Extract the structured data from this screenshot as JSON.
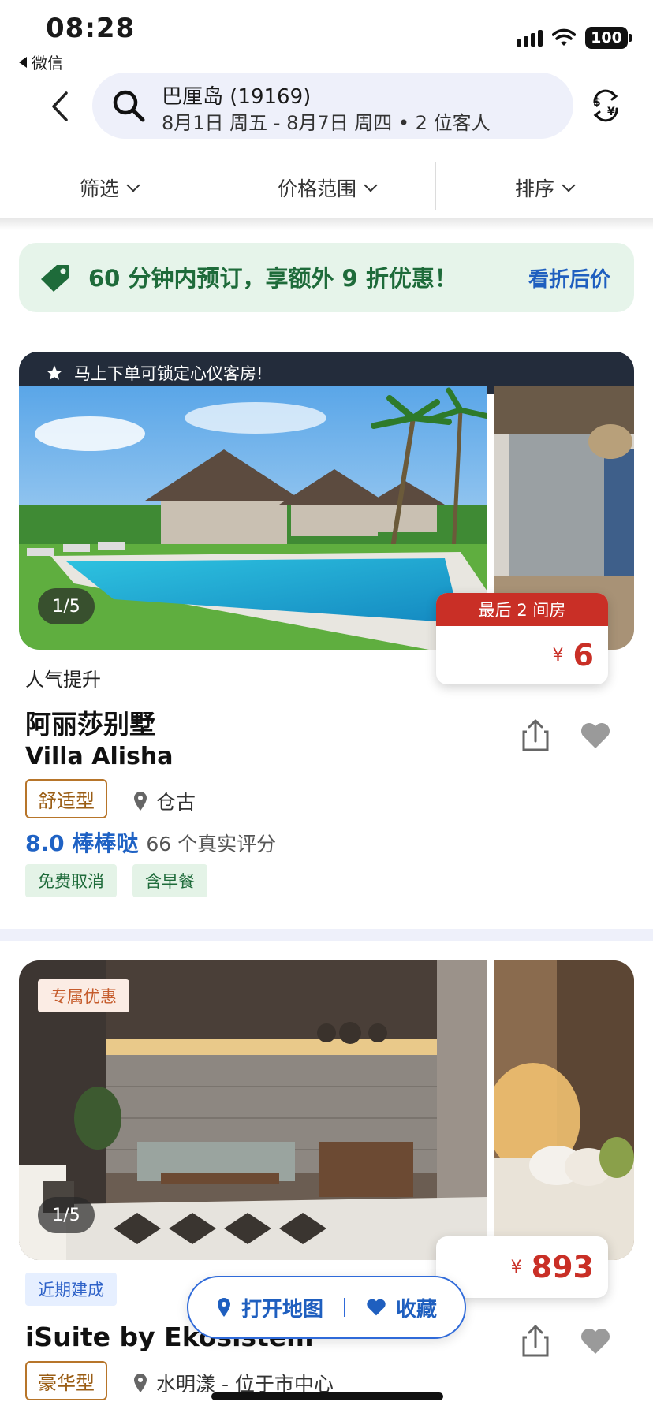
{
  "status_bar": {
    "time": "08:28",
    "back_app": "微信",
    "battery": "100"
  },
  "search": {
    "title": "巴厘岛 (19169)",
    "subtitle": "8月1日 周五 - 8月7日 周四 • 2 位客人"
  },
  "filters": {
    "filter": "筛选",
    "price_range": "价格范围",
    "sort": "排序"
  },
  "promo": {
    "text": "60 分钟内预订，享额外 9 折优惠！",
    "link": "看折后价"
  },
  "hotels": [
    {
      "banner": "马上下单可锁定心仪客房!",
      "photo_count": "1/5",
      "urgency": "最后 2 间房",
      "currency": "¥",
      "price": "6",
      "tagline": "人气提升",
      "name_zh": "阿丽莎别墅",
      "name_en": "Villa Alisha",
      "type": "舒适型",
      "location": "仓古",
      "score": "8.0 棒棒哒",
      "review_count": "66 个真实评分",
      "chips": [
        "免费取消",
        "含早餐"
      ]
    },
    {
      "exclusive": "专属优惠",
      "photo_count": "1/5",
      "currency": "¥",
      "price": "893",
      "recent": "近期建成",
      "name_en": "iSuite by Ekosistem",
      "type": "豪华型",
      "location": "水明漾 - 位于市中心"
    }
  ],
  "floating": {
    "map": "打开地图",
    "favorites": "收藏"
  },
  "colors": {
    "accent_blue": "#1f62c4",
    "price_red": "#c92f26",
    "promo_green": "#1e6b3a"
  }
}
